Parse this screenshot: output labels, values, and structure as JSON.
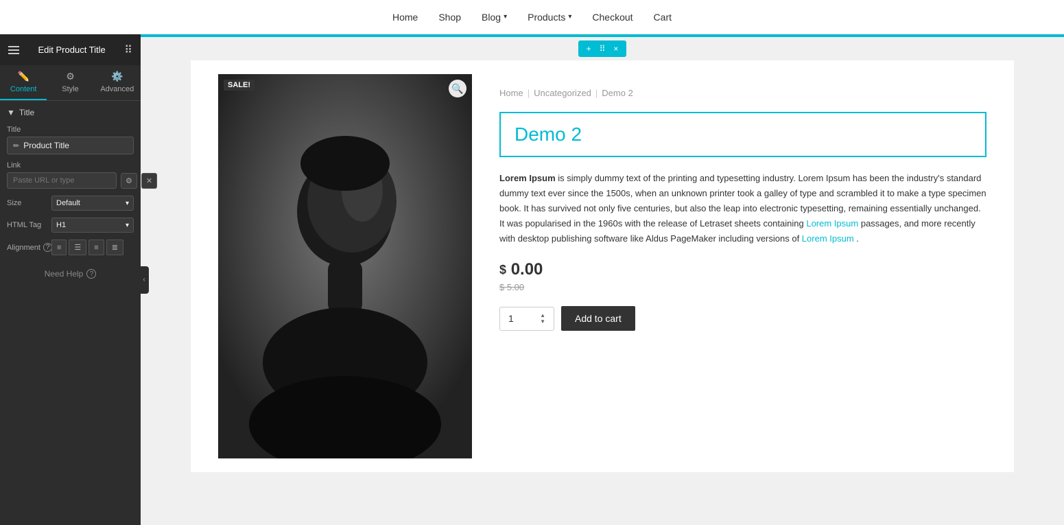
{
  "header": {
    "title": "Edit Product Title"
  },
  "nav": {
    "items": [
      {
        "label": "Home",
        "has_dropdown": false
      },
      {
        "label": "Shop",
        "has_dropdown": false
      },
      {
        "label": "Blog",
        "has_dropdown": true
      },
      {
        "label": "Products",
        "has_dropdown": true
      },
      {
        "label": "Checkout",
        "has_dropdown": false
      },
      {
        "label": "Cart",
        "has_dropdown": false
      }
    ]
  },
  "sidebar": {
    "tabs": [
      {
        "label": "Content",
        "active": true
      },
      {
        "label": "Style",
        "active": false
      },
      {
        "label": "Advanced",
        "active": false
      }
    ],
    "section_title": "Title",
    "fields": {
      "title_label": "Title",
      "title_placeholder": "Product Title",
      "link_label": "Link",
      "link_placeholder": "Paste URL or type",
      "size_label": "Size",
      "size_value": "Default",
      "html_tag_label": "HTML Tag",
      "html_tag_value": "H1",
      "alignment_label": "Alignment"
    },
    "need_help": "Need Help"
  },
  "product": {
    "sale_badge": "SALE!",
    "breadcrumb": {
      "home": "Home",
      "category": "Uncategorized",
      "current": "Demo 2"
    },
    "title": "Demo 2",
    "description_parts": [
      {
        "bold": true,
        "text": "Lorem Ipsum"
      },
      {
        "bold": false,
        "text": " is simply dummy text of the printing and typesetting industry. Lorem Ipsum has been the industry's standard dummy text ever since the 1500s, when an unknown printer took a galley of type and scrambled it to make a type specimen book. It has survived not only five centuries, but also the leap into electronic typesetting, remaining essentially unchanged. It was popularised in the 1960s with the release of Letraset sheets containing "
      },
      {
        "bold": false,
        "link": true,
        "text": "Lorem Ipsum"
      },
      {
        "bold": false,
        "text": " passages, and more recently with desktop publishing software like Aldus PageMaker including versions of "
      },
      {
        "bold": false,
        "link": true,
        "text": "Lorem Ipsum"
      },
      {
        "bold": false,
        "text": "."
      }
    ],
    "current_price": "0.00",
    "currency_symbol": "$",
    "original_price": "$ 5.00",
    "quantity": "1",
    "add_to_cart_label": "Add to cart"
  },
  "widget_toolbar": {
    "plus": "+",
    "move": "⠿",
    "close": "×"
  }
}
